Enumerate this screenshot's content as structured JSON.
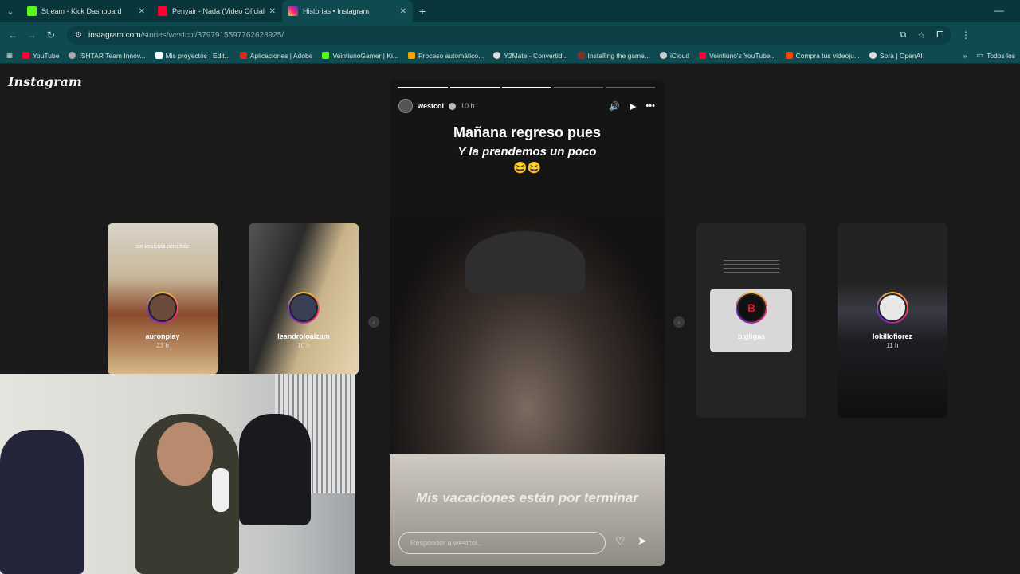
{
  "browser": {
    "tabs": [
      {
        "title": "Stream - Kick Dashboard",
        "color": "#53fc18"
      },
      {
        "title": "Penyair - Nada (Video Oficial) -",
        "color": "#ff0033"
      },
      {
        "title": "Historias • Instagram",
        "color": "#e1306c"
      }
    ],
    "url_host": "instagram.com",
    "url_path": "/stories/westcol/3797915597762628925/",
    "bookmarks": [
      {
        "label": "YouTube",
        "color": "#ff0033"
      },
      {
        "label": "ISHTAR Team Innov...",
        "color": "#aaaaaa"
      },
      {
        "label": "Mis proyectos | Edit...",
        "color": "#ffffff"
      },
      {
        "label": "Aplicaciones | Adobe",
        "color": "#e3261c"
      },
      {
        "label": "VeintiunoGamer | Ki...",
        "color": "#53fc18"
      },
      {
        "label": "Proceso automático...",
        "color": "#f4a300"
      },
      {
        "label": "Y2Mate - Convertid...",
        "color": "#dddddd"
      },
      {
        "label": "Installing the game...",
        "color": "#8a2a2a"
      },
      {
        "label": "iCloud",
        "color": "#cccccc"
      },
      {
        "label": "Veintiuno's YouTube...",
        "color": "#ff0033"
      },
      {
        "label": "Compra tus videoju...",
        "color": "#ff4400"
      },
      {
        "label": "Sora | OpenAI",
        "color": "#dddddd"
      }
    ],
    "all_bookmarks": "Todos los"
  },
  "instagram": {
    "logo": "Instagram",
    "side_stories": [
      {
        "user": "auronplay",
        "time": "23 h",
        "caption": "sin vesícula pero feliz"
      },
      {
        "user": "leandroloaizam",
        "time": "10 h"
      },
      {
        "user": "bigligas",
        "time": ""
      },
      {
        "user": "lokillofiorez",
        "time": "11 h"
      }
    ],
    "story": {
      "user": "westcol",
      "time": "10 h",
      "line1": "Mañana regreso pues",
      "line2": "Y la prendemos un poco",
      "emoji": "😆😆",
      "caption": "Mis vacaciones están por terminar",
      "reply_placeholder": "Responder a westcol..."
    }
  }
}
